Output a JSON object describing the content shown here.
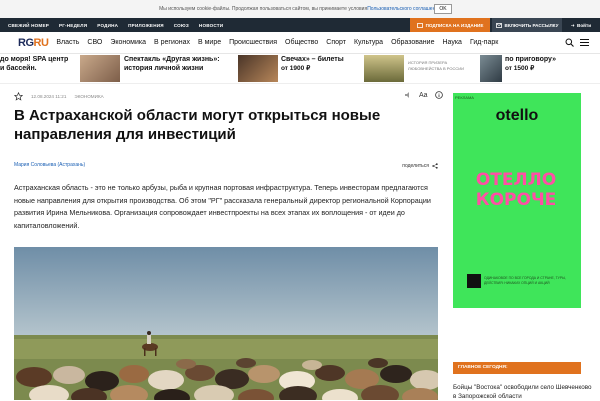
{
  "cookie": {
    "text": "Мы используем cookie-файлы. Продолжая пользоваться сайтом, вы принимаете условия ",
    "link": "Пользовательского соглашения",
    "ok": "OK"
  },
  "topbar": {
    "items": [
      "СВЕЖИЙ НОМЕР",
      "РГ-НЕДЕЛЯ",
      "РОДИНА",
      "ПРИЛОЖЕНИЯ",
      "СОЮЗ",
      "НОВОСТИ"
    ],
    "subscribe": "ПОДПИСКА НА ИЗДАНИЕ",
    "newsletter": "ВКЛЮЧИТЬ РАССЫЛКУ",
    "login": "Войти"
  },
  "nav": {
    "logo_a": "RG",
    "logo_b": "RU",
    "items": [
      "Власть",
      "СВО",
      "Экономика",
      "В регионах",
      "В мире",
      "Происшествия",
      "Общество",
      "Спорт",
      "Культура",
      "Образование",
      "Наука",
      "Гид-парк"
    ]
  },
  "promos": [
    {
      "l1": "до моря! SPA центр",
      "l2": "и бассейн."
    },
    {
      "l1": "Спектакль «Другая жизнь»:",
      "l2": "история личной жизни"
    },
    {
      "l1": "Свечах» – билеты",
      "l2": "от 1900 ₽"
    },
    {
      "l1": "ИСТОРИЯ ПРИЗЕРА",
      "l2": "ЛЮБОВНЕЙСТВА В РОССИИ"
    },
    {
      "l1": "по приговору»",
      "l2": "от 1500 ₽"
    }
  ],
  "article": {
    "date": "12.08.2024 11:21",
    "rubric": "ЭКОНОМИКА",
    "font_tool": "Aa",
    "title": "В Астраханской области могут открыться новые направления для инвестиций",
    "author": "Мария Соловьева (Астрахань)",
    "share": "поделиться",
    "lead": "Астраханская область - это не только арбузы, рыба и крупная портовая инфраструктура. Теперь инвесторам предлагаются новые направления для открытия производства. Об этом \"РГ\" рассказала генеральный директор региональной Корпорации развития Ирина Мельникова. Организация сопровождает инвестпроекты на всех этапах их воплощения - от идеи до капиталовложений."
  },
  "ad": {
    "label": "РЕКЛАМА",
    "brand": "otello",
    "slogan_1": "ОТЕЛЛО",
    "slogan_2": "КОРОЧЕ",
    "fine": "ОДИНАКОВОЕ ПО ВСЕ ГОРОДА И СТРАНЕ, ТУРЫ, ДЕЙСТВИЯ: НИКАКИХ ОПЦИЙ И АКЦИЙ"
  },
  "sidebar": {
    "header": "ГЛАВНОЕ СЕГОДНЯ:",
    "headline": "Бойцы \"Востока\" освободили село Шевченково в Запорожской области"
  },
  "colors": {
    "accent": "#e0721e",
    "dark": "#1f2a35",
    "ad_green": "#3fe55a",
    "ad_pink": "#ff4fa5",
    "link": "#1a5fb4"
  }
}
